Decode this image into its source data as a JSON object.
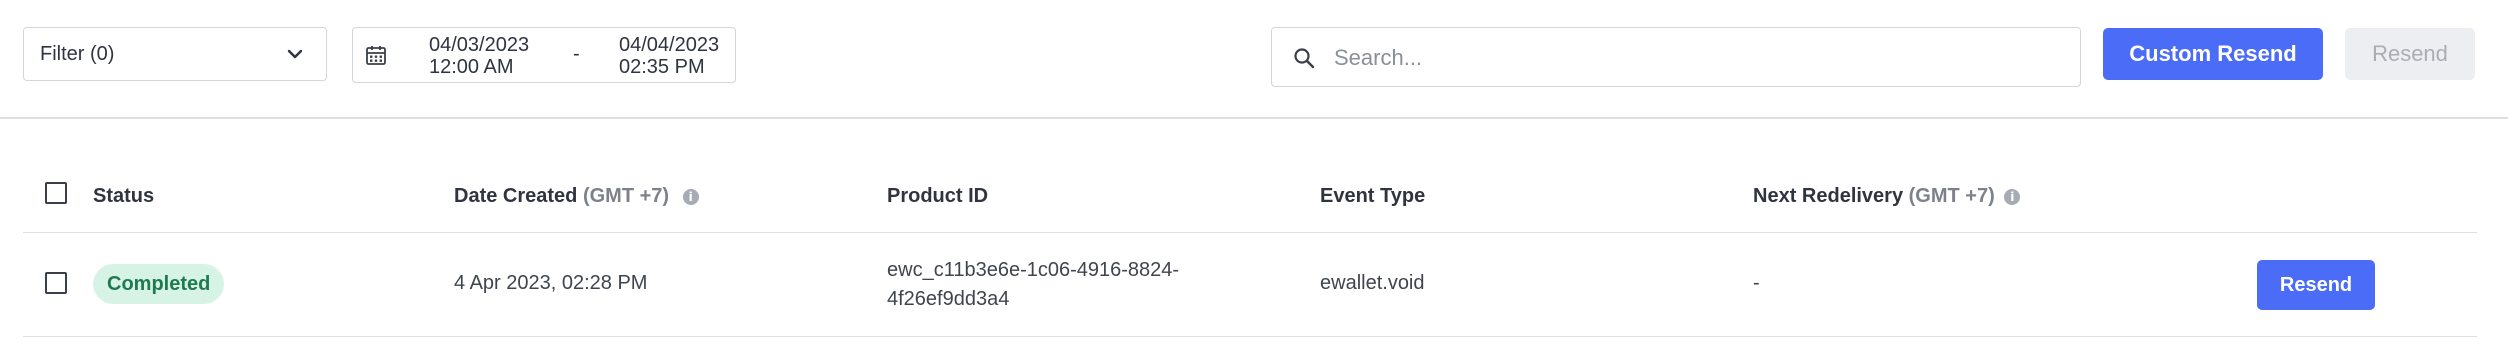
{
  "toolbar": {
    "filter_label": "Filter (0)",
    "date_from": {
      "date": "04/03/2023",
      "time": "12:00 AM"
    },
    "date_separator": "-",
    "date_to": {
      "date": "04/04/2023",
      "time": "02:35 PM"
    },
    "search_placeholder": "Search...",
    "custom_resend_label": "Custom Resend",
    "resend_label": "Resend"
  },
  "table": {
    "columns": {
      "status": "Status",
      "date_created": "Date Created",
      "date_created_tz": "(GMT +7)",
      "product_id": "Product ID",
      "event_type": "Event Type",
      "next_redelivery": "Next Redelivery",
      "next_redelivery_tz": "(GMT +7)"
    },
    "rows": [
      {
        "status": "Completed",
        "date_created": "4 Apr 2023, 02:28 PM",
        "product_id_line1": "ewc_c11b3e6e-1c06-4916-8824-",
        "product_id_line2": "4f26ef9dd3a4",
        "event_type": "ewallet.void",
        "next_redelivery": "-",
        "action_label": "Resend"
      }
    ]
  },
  "colors": {
    "primary": "#4a6cf7",
    "status_completed_bg": "#d7f3e6",
    "status_completed_text": "#1f7a52",
    "disabled_bg": "#eceef1"
  },
  "icons": {
    "filter_dropdown": "chevron-down-icon",
    "date": "calendar-icon",
    "search": "search-icon",
    "info": "info-icon"
  }
}
